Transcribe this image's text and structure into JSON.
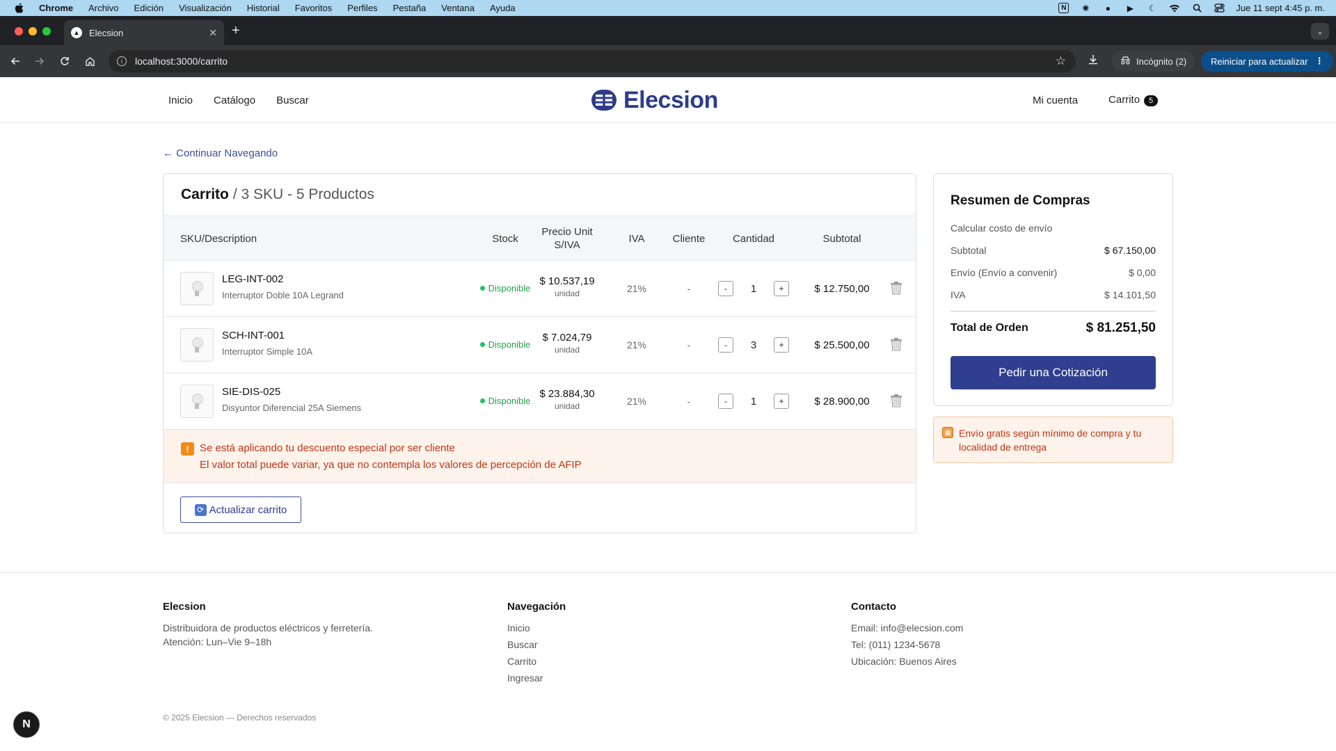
{
  "menubar": {
    "menus": [
      "Chrome",
      "Archivo",
      "Edición",
      "Visualización",
      "Historial",
      "Favoritos",
      "Perfiles",
      "Pestaña",
      "Ventana",
      "Ayuda"
    ],
    "clock": "Jue 11 sept  4:45 p. m."
  },
  "browser": {
    "tab_title": "Elecsion",
    "url": "localhost:3000/carrito",
    "incognito_label": "Incógnito (2)",
    "restart_label": "Reiniciar para actualizar"
  },
  "site": {
    "nav": {
      "home": "Inicio",
      "catalog": "Catálogo",
      "search": "Buscar"
    },
    "logo_text": "Elecsion",
    "account": "Mi cuenta",
    "cart_label": "Carrito",
    "cart_count": "5"
  },
  "cart": {
    "back_link": "← Continuar Navegando",
    "title": "Carrito",
    "subtitle": "/ 3 SKU - 5 Productos",
    "columns": {
      "sku": "SKU/Description",
      "stock": "Stock",
      "price": "Precio Unit S/IVA",
      "iva": "IVA",
      "client": "Cliente",
      "qty": "Cantidad",
      "subtotal": "Subtotal"
    },
    "items": [
      {
        "sku": "LEG-INT-002",
        "desc": "Interruptor Doble 10A Legrand",
        "stock": "Disponible",
        "price": "$ 10.537,19",
        "unit": "unidad",
        "iva": "21%",
        "client": "-",
        "qty": "1",
        "subtotal": "$ 12.750,00"
      },
      {
        "sku": "SCH-INT-001",
        "desc": "Interruptor Simple 10A",
        "stock": "Disponible",
        "price": "$ 7.024,79",
        "unit": "unidad",
        "iva": "21%",
        "client": "-",
        "qty": "3",
        "subtotal": "$ 25.500,00"
      },
      {
        "sku": "SIE-DIS-025",
        "desc": "Disyuntor Diferencial 25A Siemens",
        "stock": "Disponible",
        "price": "$ 23.884,30",
        "unit": "unidad",
        "iva": "21%",
        "client": "-",
        "qty": "1",
        "subtotal": "$ 28.900,00"
      }
    ],
    "qty_minus": "-",
    "qty_plus": "+",
    "notice_line1": "Se está aplicando tu descuento especial por ser cliente",
    "notice_line2": "El valor total puede variar, ya que no contempla los valores de percepción de AFIP",
    "update_button": "Actualizar carrito"
  },
  "summary": {
    "title": "Resumen de Compras",
    "shipping_calc": "Calcular costo de envío",
    "subtotal_label": "Subtotal",
    "subtotal_value": "$ 67.150,00",
    "shipping_label": "Envío (Envío a convenir)",
    "shipping_value": "$ 0,00",
    "iva_label": "IVA",
    "iva_value": "$ 14.101,50",
    "total_label": "Total de Orden",
    "total_value": "$ 81.251,50",
    "quote_button": "Pedir una Cotización",
    "ship_note": "Envío gratis según mínimo de compra y tu localidad de entrega"
  },
  "footer": {
    "brand": "Elecsion",
    "brand_line1": "Distribuidora de productos eléctricos y ferretería.",
    "brand_line2": "Atención: Lun–Vie 9–18h",
    "nav_title": "Navegación",
    "nav_links": [
      "Inicio",
      "Buscar",
      "Carrito",
      "Ingresar"
    ],
    "contact_title": "Contacto",
    "contact": [
      "Email: info@elecsion.com",
      "Tel: (011) 1234-5678",
      "Ubicación: Buenos Aires"
    ],
    "copyright": "© 2025 Elecsion — Derechos reservados"
  },
  "colors": {
    "brand": "#2d3c8c",
    "available": "#21a04c",
    "warning": "#c0351a",
    "cta": "#2f3e8f"
  }
}
